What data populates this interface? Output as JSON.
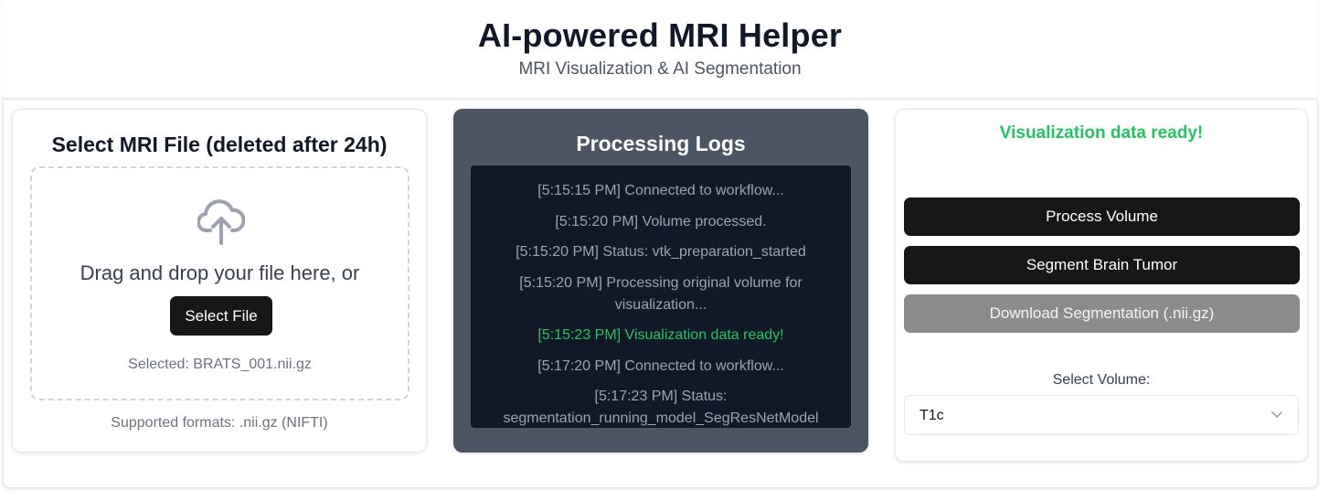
{
  "header": {
    "title": "AI-powered MRI Helper",
    "subtitle": "MRI Visualization & AI Segmentation"
  },
  "upload": {
    "title": "Select MRI File (deleted after 24h)",
    "drop_text": "Drag and drop your file here, or",
    "select_button": "Select File",
    "selected_text": "Selected: BRATS_001.nii.gz",
    "supported_formats": "Supported formats: .nii.gz (NIFTI)",
    "icon": "cloud-upload-icon"
  },
  "logs": {
    "title": "Processing Logs",
    "entries": [
      {
        "text": "[5:15:15 PM] Connected to workflow...",
        "status": "info"
      },
      {
        "text": "[5:15:20 PM] Volume processed.",
        "status": "info"
      },
      {
        "text": "[5:15:20 PM] Status: vtk_preparation_started",
        "status": "info"
      },
      {
        "text": "[5:15:20 PM] Processing original volume for visualization...",
        "status": "info"
      },
      {
        "text": "[5:15:23 PM] Visualization data ready!",
        "status": "success"
      },
      {
        "text": "[5:17:20 PM] Connected to workflow...",
        "status": "info"
      },
      {
        "text": "[5:17:23 PM] Status: segmentation_running_model_SegResNetModel",
        "status": "info"
      }
    ]
  },
  "actions": {
    "status_message": "Visualization data ready!",
    "process_button": "Process Volume",
    "segment_button": "Segment Brain Tumor",
    "download_button": "Download Segmentation (.nii.gz)",
    "volume_label": "Select Volume:",
    "volume_selected": "T1c"
  },
  "colors": {
    "primary_button": "#171717",
    "disabled_button": "#8c8c8c",
    "success": "#22c55e",
    "logs_panel": "#4b5563",
    "logs_console": "#111827"
  }
}
